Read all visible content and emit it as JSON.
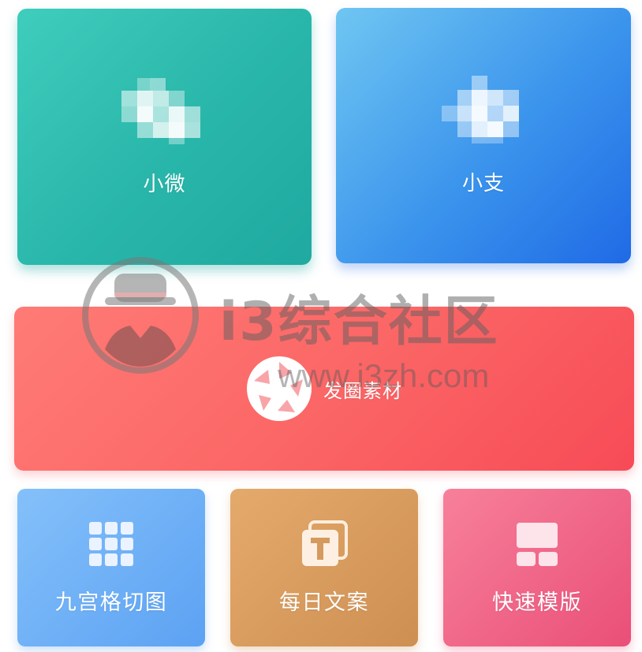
{
  "cards": {
    "weixin": {
      "label": "小微",
      "icon": "wechat-icon-pixelated"
    },
    "alipay": {
      "label": "小支",
      "icon": "alipay-icon-pixelated"
    },
    "moments": {
      "label": "发圈素材",
      "icon": "camera-shutter-icon"
    },
    "grid_cut": {
      "label": "九宫格切图",
      "icon": "grid-icon"
    },
    "daily_copy": {
      "label": "每日文案",
      "icon": "text-document-icon"
    },
    "quick_template": {
      "label": "快速模版",
      "icon": "template-layout-icon"
    }
  },
  "watermark": {
    "title": "i3综合社区",
    "url": "www.i3zh.com",
    "logo": "detective-hat-logo"
  },
  "colors": {
    "teal": "#2bb8ab",
    "blue": "#3b94ec",
    "red": "#f85b5f",
    "light_blue": "#6eb1f6",
    "orange": "#d99c5f",
    "pink": "#ef6386"
  }
}
